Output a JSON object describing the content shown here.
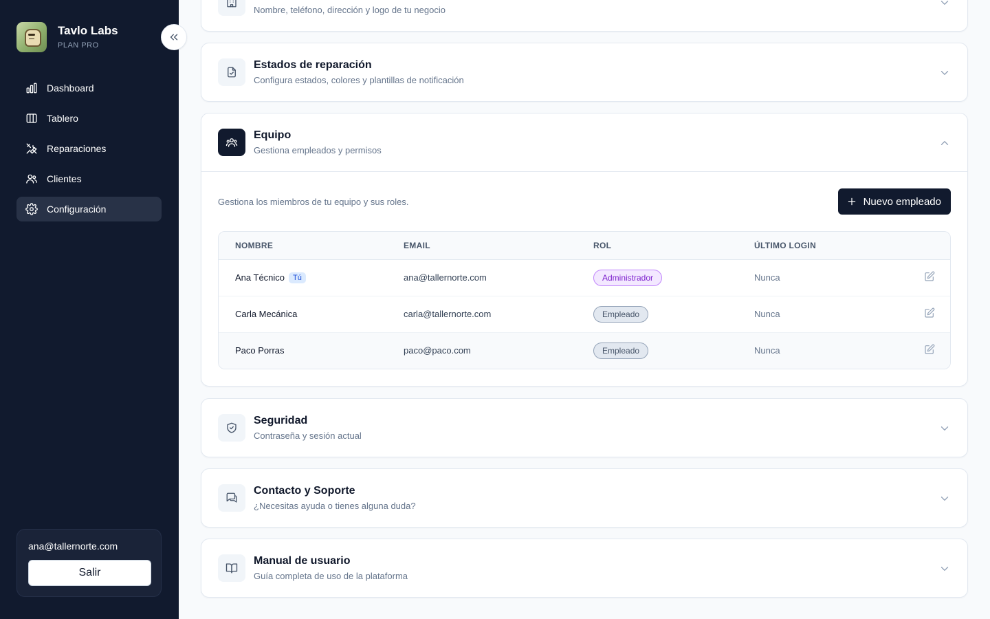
{
  "brand": {
    "name": "Tavlo Labs",
    "plan": "PLAN PRO"
  },
  "nav": [
    {
      "label": "Dashboard",
      "icon": "bar-chart-icon",
      "active": false
    },
    {
      "label": "Tablero",
      "icon": "columns-icon",
      "active": false
    },
    {
      "label": "Reparaciones",
      "icon": "tools-icon",
      "active": false
    },
    {
      "label": "Clientes",
      "icon": "users-icon",
      "active": false
    },
    {
      "label": "Configuración",
      "icon": "gear-icon",
      "active": true
    }
  ],
  "user": {
    "email": "ana@tallernorte.com",
    "logout_label": "Salir"
  },
  "sections": {
    "business": {
      "subtitle": "Nombre, teléfono, dirección y logo de tu negocio"
    },
    "statuses": {
      "title": "Estados de reparación",
      "subtitle": "Configura estados, colores y plantillas de notificación"
    },
    "team": {
      "title": "Equipo",
      "subtitle": "Gestiona empleados y permisos"
    },
    "security": {
      "title": "Seguridad",
      "subtitle": "Contraseña y sesión actual"
    },
    "support": {
      "title": "Contacto y Soporte",
      "subtitle": "¿Necesitas ayuda o tienes alguna duda?"
    },
    "manual": {
      "title": "Manual de usuario",
      "subtitle": "Guía completa de uso de la plataforma"
    }
  },
  "team": {
    "description": "Gestiona los miembros de tu equipo y sus roles.",
    "new_button": "Nuevo empleado",
    "columns": {
      "name": "NOMBRE",
      "email": "EMAIL",
      "role": "ROL",
      "last_login": "ÚLTIMO LOGIN"
    },
    "members": [
      {
        "name": "Ana Técnico",
        "badge": "Tú",
        "email": "ana@tallernorte.com",
        "role": "Administrador",
        "last_login": "Nunca"
      },
      {
        "name": "Carla Mecánica",
        "email": "carla@tallernorte.com",
        "role": "Empleado",
        "last_login": "Nunca"
      },
      {
        "name": "Paco Porras",
        "email": "paco@paco.com",
        "role": "Empleado",
        "last_login": "Nunca"
      }
    ]
  },
  "colors": {
    "sidebar": "#111a2e",
    "active_nav": "#283247",
    "admin_badge": "#f3e8ff",
    "employee_badge": "#e2e8f0"
  }
}
